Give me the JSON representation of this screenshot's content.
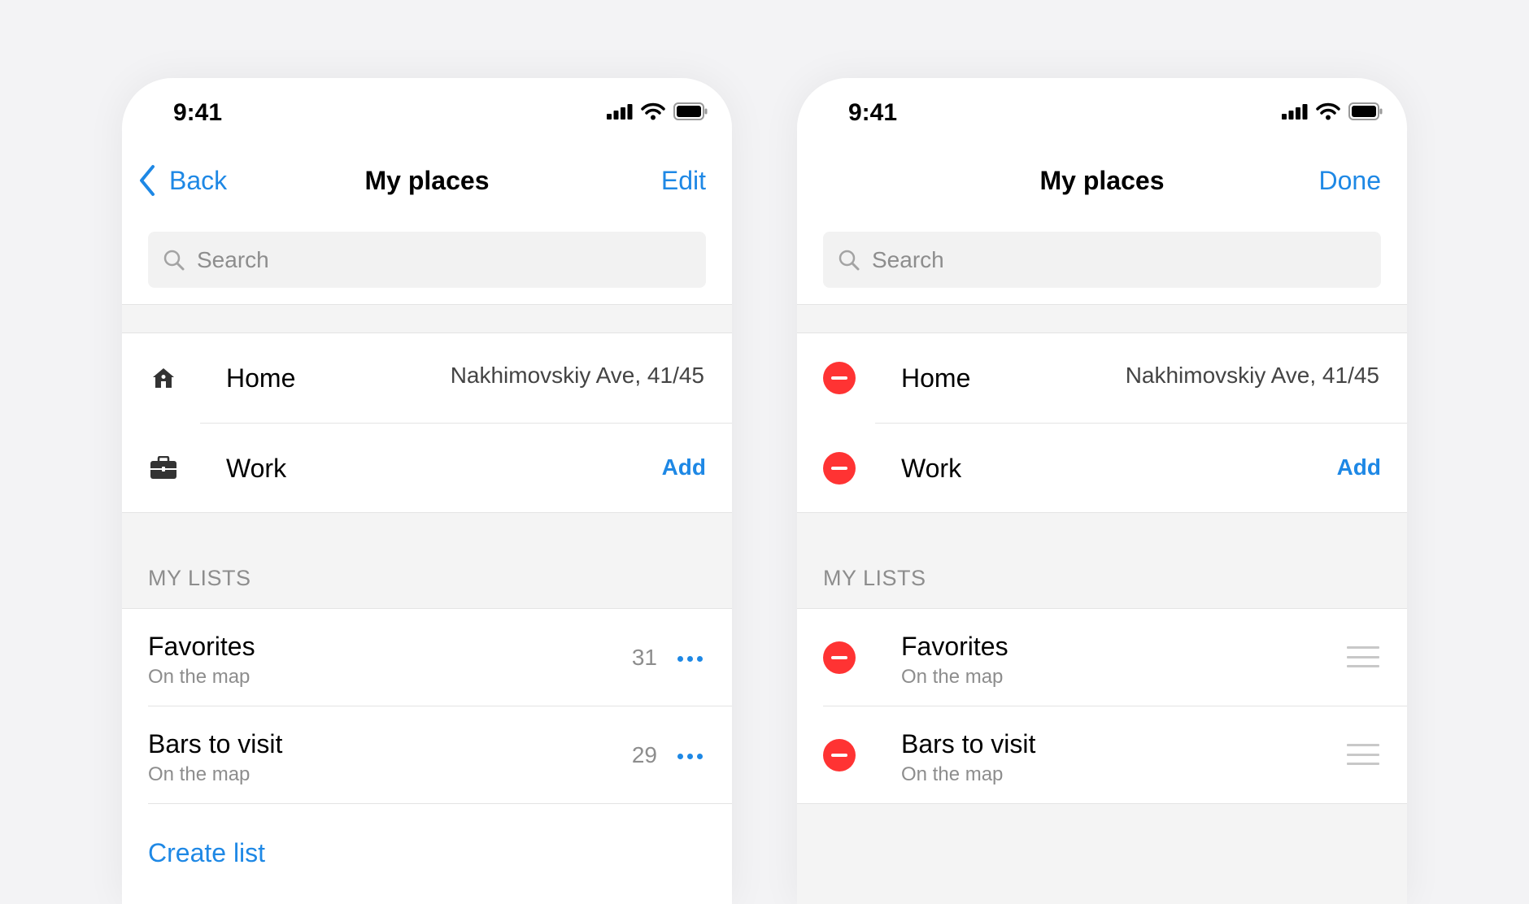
{
  "colors": {
    "accent": "#1e88e5",
    "delete": "#ff3333",
    "background": "#f3f3f5"
  },
  "left": {
    "time": "9:41",
    "nav": {
      "back": "Back",
      "title": "My places",
      "action": "Edit"
    },
    "search": {
      "placeholder": "Search"
    },
    "places": [
      {
        "icon": "home-icon",
        "label": "Home",
        "value": "Nakhimovskiy Ave, 41/45"
      },
      {
        "icon": "briefcase-icon",
        "label": "Work",
        "action": "Add"
      }
    ],
    "section_header": "MY LISTS",
    "lists": [
      {
        "title": "Favorites",
        "subtitle": "On the map",
        "count": "31"
      },
      {
        "title": "Bars to visit",
        "subtitle": "On the map",
        "count": "29"
      }
    ],
    "create_list": "Create list"
  },
  "right": {
    "time": "9:41",
    "nav": {
      "title": "My places",
      "action": "Done"
    },
    "search": {
      "placeholder": "Search"
    },
    "places": [
      {
        "icon": "delete-icon",
        "label": "Home",
        "value": "Nakhimovskiy Ave, 41/45"
      },
      {
        "icon": "delete-icon",
        "label": "Work",
        "action": "Add"
      }
    ],
    "section_header": "MY LISTS",
    "lists": [
      {
        "title": "Favorites",
        "subtitle": "On the map"
      },
      {
        "title": "Bars to visit",
        "subtitle": "On the map"
      }
    ]
  }
}
